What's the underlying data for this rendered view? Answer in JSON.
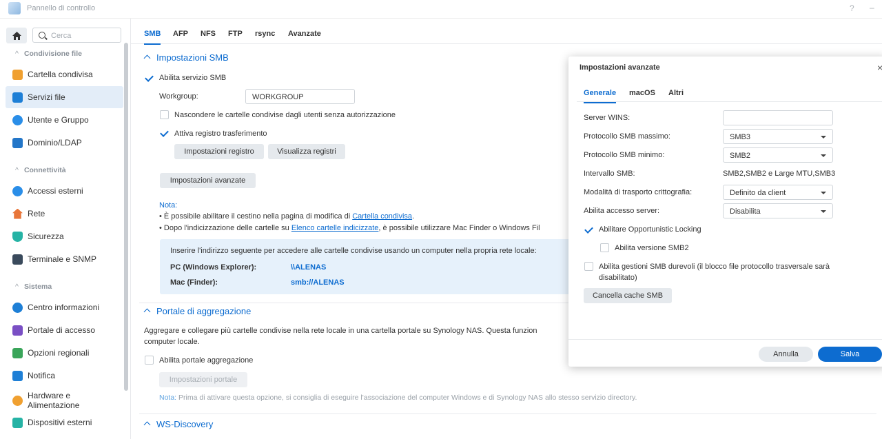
{
  "titlebar": {
    "title": "Pannello di controllo",
    "help": "?",
    "minimize": "–"
  },
  "sidebar": {
    "search_placeholder": "Cerca",
    "sections": [
      {
        "label": "Condivisione file",
        "items": [
          {
            "label": "Cartella condivisa",
            "icon": "shared-folder-icon",
            "color": "#f0a030"
          },
          {
            "label": "Servizi file",
            "icon": "file-services-icon",
            "color": "#1e7fd6",
            "active": true
          },
          {
            "label": "Utente e Gruppo",
            "icon": "user-group-icon",
            "color": "#2a8ee8"
          },
          {
            "label": "Dominio/LDAP",
            "icon": "domain-ldap-icon",
            "color": "#2376c8"
          }
        ]
      },
      {
        "label": "Connettività",
        "items": [
          {
            "label": "Accessi esterni",
            "icon": "external-access-icon",
            "color": "#2a8ee8"
          },
          {
            "label": "Rete",
            "icon": "network-icon",
            "color": "#e8763a"
          },
          {
            "label": "Sicurezza",
            "icon": "security-shield-icon",
            "color": "#26b3a5"
          },
          {
            "label": "Terminale e SNMP",
            "icon": "terminal-icon",
            "color": "#3a4a5c"
          }
        ]
      },
      {
        "label": "Sistema",
        "items": [
          {
            "label": "Centro informazioni",
            "icon": "info-center-icon",
            "color": "#1e7fd6"
          },
          {
            "label": "Portale di accesso",
            "icon": "login-portal-icon",
            "color": "#7a4fc4"
          },
          {
            "label": "Opzioni regionali",
            "icon": "regional-options-icon",
            "color": "#3aa55a"
          },
          {
            "label": "Notifica",
            "icon": "notification-icon",
            "color": "#1e7fd6"
          },
          {
            "label": "Hardware e Alimentazione",
            "icon": "hardware-power-icon",
            "color": "#f0a030"
          },
          {
            "label": "Dispositivi esterni",
            "icon": "external-devices-icon",
            "color": "#26b3a5"
          }
        ]
      }
    ]
  },
  "tabs": [
    "SMB",
    "AFP",
    "NFS",
    "FTP",
    "rsync",
    "Avanzate"
  ],
  "smb": {
    "heading": "Impostazioni SMB",
    "enable_label": "Abilita servizio SMB",
    "workgroup_label": "Workgroup:",
    "workgroup_value": "WORKGROUP",
    "hide_label": "Nascondere le cartelle condivise dagli utenti senza autorizzazione",
    "log_label": "Attiva registro trasferimento",
    "log_settings_btn": "Impostazioni registro",
    "view_logs_btn": "Visualizza registri",
    "advanced_btn": "Impostazioni avanzate",
    "note_title": "Nota:",
    "note1_pre": "• È possibile abilitare il cestino nella pagina di modifica di ",
    "note1_link": "Cartella condivisa",
    "note1_post": ".",
    "note2_pre": "• Dopo l'indicizzazione delle cartelle su ",
    "note2_link": "Elenco cartelle indicizzate",
    "note2_post": ", è possibile utilizzare Mac Finder o Windows Fil",
    "info_text": "Inserire l'indirizzo seguente per accedere alle cartelle condivise usando un computer nella propria rete locale:",
    "pc_label": "PC (Windows Explorer):",
    "pc_value": "\\\\ALENAS",
    "mac_label": "Mac (Finder):",
    "mac_value": "smb://ALENAS"
  },
  "portal": {
    "heading": "Portale di aggregazione",
    "desc1": "Aggregare e collegare più cartelle condivise nella rete locale in una cartella portale su Synology NAS. Questa funzion",
    "desc2": "computer locale.",
    "enable_label": "Abilita portale aggregazione",
    "settings_btn": "Impostazioni portale",
    "note_prefix": "Nota:",
    "note_text": " Prima di attivare questa opzione, si consiglia di eseguire l'associazione del computer Windows e di Synology NAS allo stesso servizio directory."
  },
  "ws": {
    "heading": "WS-Discovery"
  },
  "dialog": {
    "title": "Impostazioni avanzate",
    "close": "×",
    "tabs": [
      "Generale",
      "macOS",
      "Altri"
    ],
    "wins_label": "Server WINS:",
    "wins_value": "",
    "max_label": "Protocollo SMB massimo:",
    "max_value": "SMB3",
    "min_label": "Protocollo SMB minimo:",
    "min_value": "SMB2",
    "range_label": "Intervallo SMB:",
    "range_value": "SMB2,SMB2 e Large MTU,SMB3",
    "crypto_label": "Modalità di trasporto crittografia:",
    "crypto_value": "Definito da client",
    "server_label": "Abilita accesso server:",
    "server_value": "Disabilita",
    "oplock_label": "Abilitare Opportunistic Locking",
    "smb2lease_label": "Abilita versione SMB2",
    "durable_label1": "Abilita gestioni SMB durevoli (il blocco file protocollo trasversale sarà",
    "durable_label2": "disabilitato)",
    "clear_cache_btn": "Cancella cache SMB",
    "cancel_btn": "Annulla",
    "save_btn": "Salva"
  }
}
